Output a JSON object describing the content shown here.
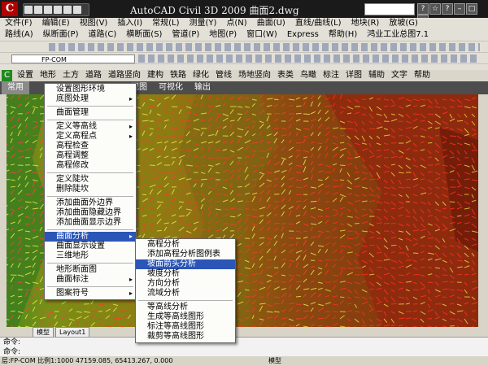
{
  "app": {
    "title": "AutoCAD Civil 3D 2009  曲面2.dwg",
    "icon_letter": "C"
  },
  "menubar1": [
    "文件(F)",
    "编辑(E)",
    "视图(V)",
    "插入(I)",
    "常规(L)",
    "测量(Y)",
    "点(N)",
    "曲面(U)",
    "直线/曲线(L)",
    "地块(R)",
    "放坡(G)"
  ],
  "menubar2": [
    "路线(A)",
    "纵断面(P)",
    "道路(C)",
    "横断面(S)",
    "管道(P)",
    "地图(P)",
    "窗口(W)",
    "Express",
    "帮助(H)",
    "鸿业工业总图7.1"
  ],
  "layer": {
    "value": "FP-COM"
  },
  "ribbon_tabs": [
    "设置",
    "地形",
    "土方",
    "道路",
    "道路竖向",
    "建构",
    "铁路",
    "绿化",
    "管线",
    "场地竖向",
    "表类",
    "鸟瞰",
    "标注",
    "详图",
    "辅助",
    "文字",
    "帮助"
  ],
  "ribbon_row2": [
    "常用",
    "视图",
    "可视化",
    "输出"
  ],
  "main_menu": [
    {
      "label": "设置图形环境",
      "arrow": false
    },
    {
      "label": "底图处理",
      "arrow": true
    },
    {
      "sep": true
    },
    {
      "label": "曲面管理",
      "arrow": false
    },
    {
      "sep": true
    },
    {
      "label": "定义等高线",
      "arrow": true
    },
    {
      "label": "定义高程点",
      "arrow": true
    },
    {
      "label": "高程检查",
      "arrow": false
    },
    {
      "label": "高程调整",
      "arrow": false
    },
    {
      "label": "高程修改",
      "arrow": false
    },
    {
      "sep": true
    },
    {
      "label": "定义陡坎",
      "arrow": false
    },
    {
      "label": "删除陡坎",
      "arrow": false
    },
    {
      "sep": true
    },
    {
      "label": "添加曲面外边界",
      "arrow": false
    },
    {
      "label": "添加曲面隐藏边界",
      "arrow": false
    },
    {
      "label": "添加曲面显示边界",
      "arrow": false
    },
    {
      "sep": true
    },
    {
      "label": "曲面分析",
      "arrow": true,
      "highlight": true
    },
    {
      "label": "曲面显示设置",
      "arrow": false
    },
    {
      "label": "三维地形",
      "arrow": false
    },
    {
      "sep": true
    },
    {
      "label": "地形断面图",
      "arrow": false
    },
    {
      "label": "曲面标注",
      "arrow": true
    },
    {
      "sep": true
    },
    {
      "label": "图案符号",
      "arrow": true
    }
  ],
  "sub_menu": [
    {
      "label": "高程分析"
    },
    {
      "label": "添加高程分析图例表"
    },
    {
      "label": "坡面箭头分析",
      "highlight": true
    },
    {
      "label": "坡度分析"
    },
    {
      "label": "方向分析"
    },
    {
      "label": "流域分析"
    },
    {
      "sep": true
    },
    {
      "label": "等高线分析"
    },
    {
      "label": "生成等高线图形"
    },
    {
      "label": "标注等高线图形"
    },
    {
      "label": "裁剪等高线图形"
    }
  ],
  "layout_tabs": [
    "模型",
    "Layout1"
  ],
  "command": {
    "line1": "命令:",
    "line2": "命令:"
  },
  "status": {
    "text": "层:FP-COM 比例1:1000  47159.085, 65413.267, 0.000",
    "model": "模型"
  },
  "colors": {
    "terrain_red": "#8f2a0e",
    "terrain_olive": "#8e7a12",
    "terrain_green": "#3f7d1e",
    "highlight": "#2b56b8"
  }
}
